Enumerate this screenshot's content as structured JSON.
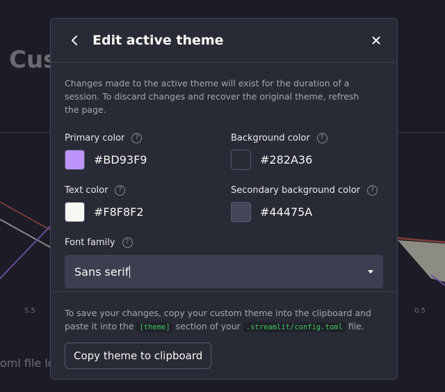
{
  "background": {
    "title": "Cus",
    "ticks": [
      "5.5",
      "0.5"
    ],
    "footer_text": "oml file loc"
  },
  "dialog": {
    "title": "Edit active theme",
    "intro": "Changes made to the active theme will exist for the duration of a session. To discard changes and recover the original theme, refresh the page.",
    "colors": [
      {
        "label": "Primary color",
        "hex": "#BD93F9",
        "swatch": "#BD93F9"
      },
      {
        "label": "Background color",
        "hex": "#282A36",
        "swatch": "#282A36"
      },
      {
        "label": "Text color",
        "hex": "#F8F8F2",
        "swatch": "#F8F8F2"
      },
      {
        "label": "Secondary background color",
        "hex": "#44475A",
        "swatch": "#44475A"
      }
    ],
    "font_family": {
      "label": "Font family",
      "value": "Sans serif"
    },
    "help_glyph": "?",
    "footer": {
      "text_1": "To save your changes, copy your custom theme into the clipboard and paste it into the ",
      "code_1": "[theme]",
      "text_2": " section of your ",
      "code_2": ".streamlit/config.toml",
      "text_3": " file.",
      "copy_button": "Copy theme to clipboard"
    }
  },
  "icons": {
    "back": "chevron-left-icon",
    "close": "close-icon",
    "help": "help-circle-icon",
    "dropdown": "caret-down-icon"
  }
}
